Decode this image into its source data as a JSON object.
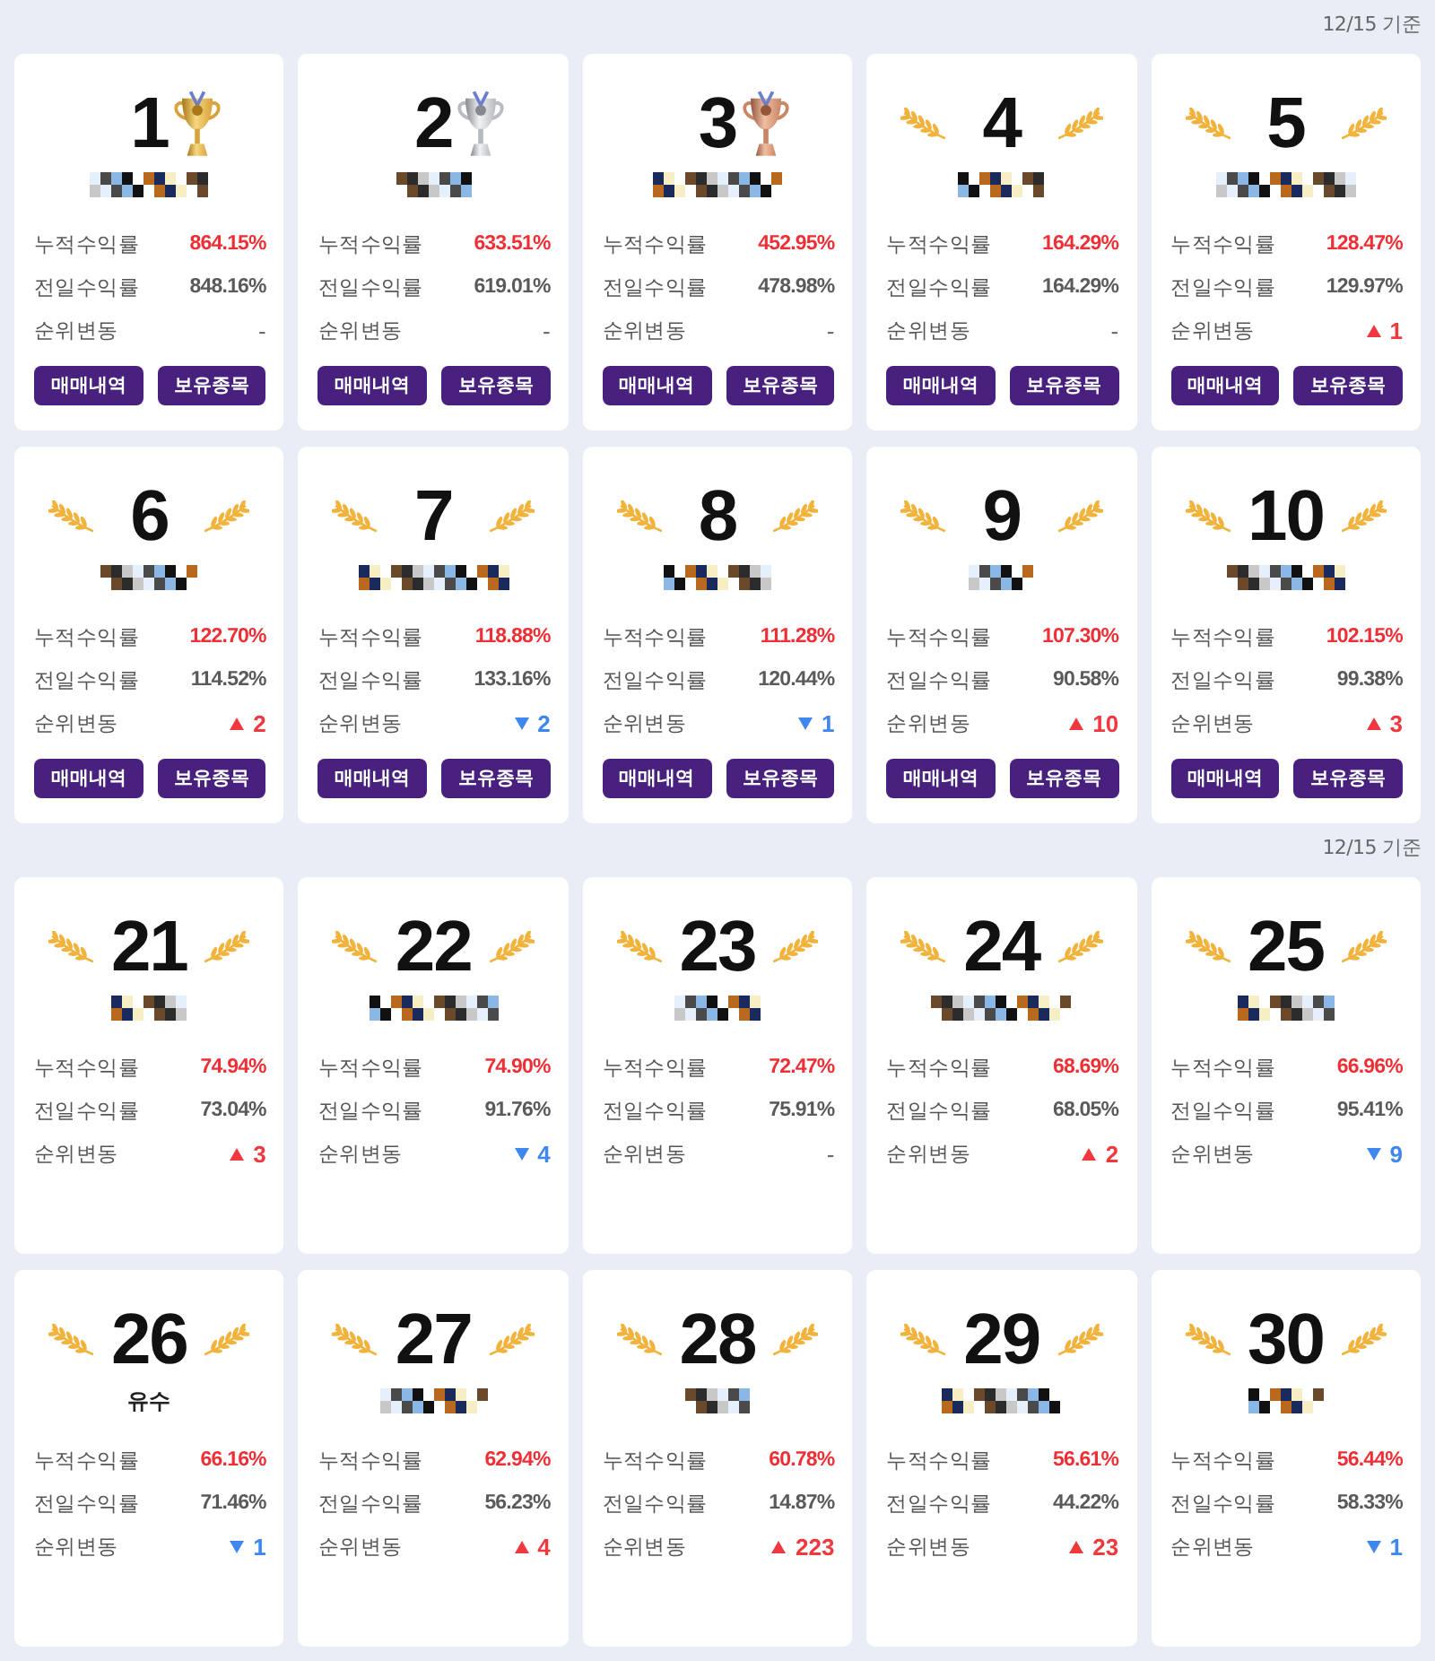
{
  "sections": [
    {
      "date_label": "12/15 기준",
      "cards": [
        {
          "rank": "1",
          "kind": "gold_trophy",
          "stats": [
            {
              "kind": "cumulative",
              "label": "누적수익률",
              "value": "864.15%"
            },
            {
              "kind": "daily",
              "label": "전일수익률",
              "value": "848.16%"
            },
            {
              "kind": "rank_change",
              "label": "순위변동",
              "change": {
                "kind": "same",
                "value": "-"
              }
            }
          ],
          "buttons": [
            "매매내역",
            "보유종목"
          ]
        },
        {
          "rank": "2",
          "kind": "silver_trophy",
          "stats": [
            {
              "kind": "cumulative",
              "label": "누적수익률",
              "value": "633.51%"
            },
            {
              "kind": "daily",
              "label": "전일수익률",
              "value": "619.01%"
            },
            {
              "kind": "rank_change",
              "label": "순위변동",
              "change": {
                "kind": "same",
                "value": "-"
              }
            }
          ],
          "buttons": [
            "매매내역",
            "보유종목"
          ]
        },
        {
          "rank": "3",
          "kind": "bronze_trophy",
          "stats": [
            {
              "kind": "cumulative",
              "label": "누적수익률",
              "value": "452.95%"
            },
            {
              "kind": "daily",
              "label": "전일수익률",
              "value": "478.98%"
            },
            {
              "kind": "rank_change",
              "label": "순위변동",
              "change": {
                "kind": "same",
                "value": "-"
              }
            }
          ],
          "buttons": [
            "매매내역",
            "보유종목"
          ]
        },
        {
          "rank": "4",
          "kind": "laurel",
          "stats": [
            {
              "kind": "cumulative",
              "label": "누적수익률",
              "value": "164.29%"
            },
            {
              "kind": "daily",
              "label": "전일수익률",
              "value": "164.29%"
            },
            {
              "kind": "rank_change",
              "label": "순위변동",
              "change": {
                "kind": "same",
                "value": "-"
              }
            }
          ],
          "buttons": [
            "매매내역",
            "보유종목"
          ]
        },
        {
          "rank": "5",
          "kind": "laurel",
          "stats": [
            {
              "kind": "cumulative",
              "label": "누적수익률",
              "value": "128.47%"
            },
            {
              "kind": "daily",
              "label": "전일수익률",
              "value": "129.97%"
            },
            {
              "kind": "rank_change",
              "label": "순위변동",
              "change": {
                "kind": "up",
                "value": "1"
              }
            }
          ],
          "buttons": [
            "매매내역",
            "보유종목"
          ]
        },
        {
          "rank": "6",
          "kind": "laurel",
          "stats": [
            {
              "kind": "cumulative",
              "label": "누적수익률",
              "value": "122.70%"
            },
            {
              "kind": "daily",
              "label": "전일수익률",
              "value": "114.52%"
            },
            {
              "kind": "rank_change",
              "label": "순위변동",
              "change": {
                "kind": "up",
                "value": "2"
              }
            }
          ],
          "buttons": [
            "매매내역",
            "보유종목"
          ]
        },
        {
          "rank": "7",
          "kind": "laurel",
          "stats": [
            {
              "kind": "cumulative",
              "label": "누적수익률",
              "value": "118.88%"
            },
            {
              "kind": "daily",
              "label": "전일수익률",
              "value": "133.16%"
            },
            {
              "kind": "rank_change",
              "label": "순위변동",
              "change": {
                "kind": "down",
                "value": "2"
              }
            }
          ],
          "buttons": [
            "매매내역",
            "보유종목"
          ]
        },
        {
          "rank": "8",
          "kind": "laurel",
          "stats": [
            {
              "kind": "cumulative",
              "label": "누적수익률",
              "value": "111.28%"
            },
            {
              "kind": "daily",
              "label": "전일수익률",
              "value": "120.44%"
            },
            {
              "kind": "rank_change",
              "label": "순위변동",
              "change": {
                "kind": "down",
                "value": "1"
              }
            }
          ],
          "buttons": [
            "매매내역",
            "보유종목"
          ]
        },
        {
          "rank": "9",
          "kind": "laurel",
          "stats": [
            {
              "kind": "cumulative",
              "label": "누적수익률",
              "value": "107.30%"
            },
            {
              "kind": "daily",
              "label": "전일수익률",
              "value": "90.58%"
            },
            {
              "kind": "rank_change",
              "label": "순위변동",
              "change": {
                "kind": "up",
                "value": "10"
              }
            }
          ],
          "buttons": [
            "매매내역",
            "보유종목"
          ]
        },
        {
          "rank": "10",
          "kind": "laurel",
          "stats": [
            {
              "kind": "cumulative",
              "label": "누적수익률",
              "value": "102.15%"
            },
            {
              "kind": "daily",
              "label": "전일수익률",
              "value": "99.38%"
            },
            {
              "kind": "rank_change",
              "label": "순위변동",
              "change": {
                "kind": "up",
                "value": "3"
              }
            }
          ],
          "buttons": [
            "매매내역",
            "보유종목"
          ]
        }
      ]
    },
    {
      "date_label": "12/15 기준",
      "cards": [
        {
          "rank": "21",
          "kind": "laurel",
          "stats": [
            {
              "kind": "cumulative",
              "label": "누적수익률",
              "value": "74.94%"
            },
            {
              "kind": "daily",
              "label": "전일수익률",
              "value": "73.04%"
            },
            {
              "kind": "rank_change",
              "label": "순위변동",
              "change": {
                "kind": "up",
                "value": "3"
              }
            }
          ]
        },
        {
          "rank": "22",
          "kind": "laurel",
          "stats": [
            {
              "kind": "cumulative",
              "label": "누적수익률",
              "value": "74.90%"
            },
            {
              "kind": "daily",
              "label": "전일수익률",
              "value": "91.76%"
            },
            {
              "kind": "rank_change",
              "label": "순위변동",
              "change": {
                "kind": "down",
                "value": "4"
              }
            }
          ]
        },
        {
          "rank": "23",
          "kind": "laurel",
          "stats": [
            {
              "kind": "cumulative",
              "label": "누적수익률",
              "value": "72.47%"
            },
            {
              "kind": "daily",
              "label": "전일수익률",
              "value": "75.91%"
            },
            {
              "kind": "rank_change",
              "label": "순위변동",
              "change": {
                "kind": "same",
                "value": "-"
              }
            }
          ]
        },
        {
          "rank": "24",
          "kind": "laurel",
          "stats": [
            {
              "kind": "cumulative",
              "label": "누적수익률",
              "value": "68.69%"
            },
            {
              "kind": "daily",
              "label": "전일수익률",
              "value": "68.05%"
            },
            {
              "kind": "rank_change",
              "label": "순위변동",
              "change": {
                "kind": "up",
                "value": "2"
              }
            }
          ]
        },
        {
          "rank": "25",
          "kind": "laurel",
          "stats": [
            {
              "kind": "cumulative",
              "label": "누적수익률",
              "value": "66.96%"
            },
            {
              "kind": "daily",
              "label": "전일수익률",
              "value": "95.41%"
            },
            {
              "kind": "rank_change",
              "label": "순위변동",
              "change": {
                "kind": "down",
                "value": "9"
              }
            }
          ]
        },
        {
          "rank": "26",
          "kind": "laurel",
          "name": "유수",
          "stats": [
            {
              "kind": "cumulative",
              "label": "누적수익률",
              "value": "66.16%"
            },
            {
              "kind": "daily",
              "label": "전일수익률",
              "value": "71.46%"
            },
            {
              "kind": "rank_change",
              "label": "순위변동",
              "change": {
                "kind": "down",
                "value": "1"
              }
            }
          ]
        },
        {
          "rank": "27",
          "kind": "laurel",
          "stats": [
            {
              "kind": "cumulative",
              "label": "누적수익률",
              "value": "62.94%"
            },
            {
              "kind": "daily",
              "label": "전일수익률",
              "value": "56.23%"
            },
            {
              "kind": "rank_change",
              "label": "순위변동",
              "change": {
                "kind": "up",
                "value": "4"
              }
            }
          ]
        },
        {
          "rank": "28",
          "kind": "laurel",
          "stats": [
            {
              "kind": "cumulative",
              "label": "누적수익률",
              "value": "60.78%"
            },
            {
              "kind": "daily",
              "label": "전일수익률",
              "value": "14.87%"
            },
            {
              "kind": "rank_change",
              "label": "순위변동",
              "change": {
                "kind": "up",
                "value": "223"
              }
            }
          ]
        },
        {
          "rank": "29",
          "kind": "laurel",
          "stats": [
            {
              "kind": "cumulative",
              "label": "누적수익률",
              "value": "56.61%"
            },
            {
              "kind": "daily",
              "label": "전일수익률",
              "value": "44.22%"
            },
            {
              "kind": "rank_change",
              "label": "순위변동",
              "change": {
                "kind": "up",
                "value": "23"
              }
            }
          ]
        },
        {
          "rank": "30",
          "kind": "laurel",
          "stats": [
            {
              "kind": "cumulative",
              "label": "누적수익률",
              "value": "56.44%"
            },
            {
              "kind": "daily",
              "label": "전일수익률",
              "value": "58.33%"
            },
            {
              "kind": "rank_change",
              "label": "순위변동",
              "change": {
                "kind": "down",
                "value": "1"
              }
            }
          ]
        }
      ]
    }
  ]
}
